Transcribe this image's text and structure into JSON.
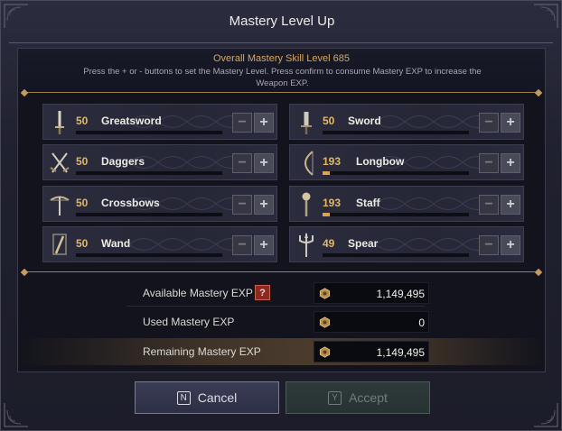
{
  "dialog": {
    "title": "Mastery Level Up",
    "overall_label": "Overall Mastery Skill Level 685",
    "instructions": "Press the + or - buttons to set the Mastery Level. Press confirm to consume Mastery EXP to increase the Weapon EXP."
  },
  "weapons": [
    {
      "level": "50",
      "name": "Greatsword",
      "icon": "greatsword-icon",
      "progress": 0
    },
    {
      "level": "50",
      "name": "Sword",
      "icon": "sword-icon",
      "progress": 0
    },
    {
      "level": "50",
      "name": "Daggers",
      "icon": "daggers-icon",
      "progress": 0
    },
    {
      "level": "193",
      "name": "Longbow",
      "icon": "longbow-icon",
      "progress": 0.05
    },
    {
      "level": "50",
      "name": "Crossbows",
      "icon": "crossbow-icon",
      "progress": 0
    },
    {
      "level": "193",
      "name": "Staff",
      "icon": "staff-icon",
      "progress": 0.05
    },
    {
      "level": "50",
      "name": "Wand",
      "icon": "wand-icon",
      "progress": 0
    },
    {
      "level": "49",
      "name": "Spear",
      "icon": "spear-icon",
      "progress": 0
    }
  ],
  "controls": {
    "minus": "−",
    "plus": "+"
  },
  "exp": {
    "available_label": "Available Mastery EXP",
    "available_value": "1,149,495",
    "help": "?",
    "used_label": "Used Mastery EXP",
    "used_value": "0",
    "remaining_label": "Remaining Mastery EXP",
    "remaining_value": "1,149,495"
  },
  "buttons": {
    "cancel_key": "N",
    "cancel_label": "Cancel",
    "accept_key": "Y",
    "accept_label": "Accept"
  },
  "colors": {
    "accent_gold": "#d9a65a",
    "level_gold": "#e2b866",
    "help_red": "#8b2a22"
  }
}
